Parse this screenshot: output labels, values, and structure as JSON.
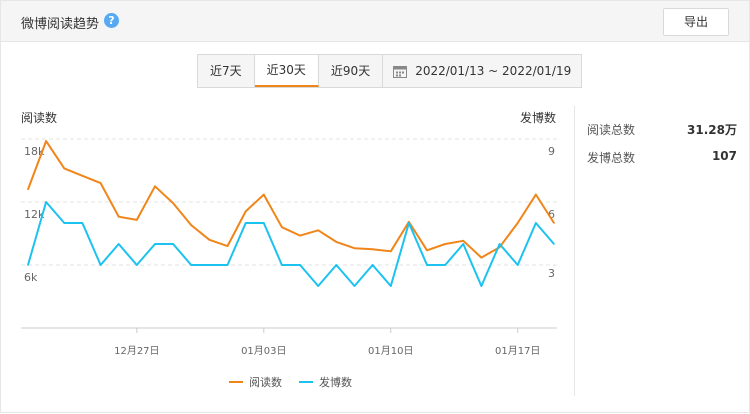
{
  "header": {
    "title": "微博阅读趋势",
    "help_icon": "?",
    "export_label": "导出"
  },
  "range": {
    "options": [
      "近7天",
      "近30天",
      "近90天"
    ],
    "active": "近30天",
    "date_range": "2022/01/13 ~ 2022/01/19"
  },
  "stats": {
    "read_label": "阅读总数",
    "read_value": "31.28万",
    "post_label": "发博总数",
    "post_value": "107"
  },
  "chart_data": {
    "type": "line",
    "y_left_label": "阅读数",
    "y_right_label": "发博数",
    "y_left_ticks": [
      "18k",
      "12k",
      "6k"
    ],
    "y_right_ticks": [
      "9",
      "6",
      "3"
    ],
    "y_left_range": [
      0,
      18000
    ],
    "y_right_range": [
      0,
      9
    ],
    "x_labels": [
      "12月27日",
      "01月03日",
      "01月10日",
      "01月17日"
    ],
    "x": [
      "12/21",
      "12/22",
      "12/23",
      "12/24",
      "12/25",
      "12/26",
      "12/27",
      "12/28",
      "12/29",
      "12/30",
      "12/31",
      "01/01",
      "01/02",
      "01/03",
      "01/04",
      "01/05",
      "01/06",
      "01/07",
      "01/08",
      "01/09",
      "01/10",
      "01/11",
      "01/12",
      "01/13",
      "01/14",
      "01/15",
      "01/16",
      "01/17",
      "01/18",
      "01/19"
    ],
    "series": [
      {
        "name": "阅读数",
        "color": "#f08519",
        "axis": "left",
        "values": [
          13200,
          17800,
          15200,
          14500,
          13800,
          10600,
          10300,
          13500,
          11900,
          9800,
          8400,
          7800,
          11100,
          12700,
          9600,
          8800,
          9300,
          8200,
          7600,
          7500,
          7300,
          10100,
          7400,
          8000,
          8300,
          6700,
          7700,
          10000,
          12700,
          10000
        ]
      },
      {
        "name": "发博数",
        "color": "#1cc2f0",
        "axis": "right",
        "values": [
          3,
          6,
          5,
          5,
          3,
          4,
          3,
          4,
          4,
          3,
          3,
          3,
          5,
          5,
          3,
          3,
          2,
          3,
          2,
          3,
          2,
          5,
          3,
          3,
          4,
          2,
          4,
          3,
          5,
          4
        ]
      }
    ],
    "grid": true,
    "legend": "bottom"
  }
}
